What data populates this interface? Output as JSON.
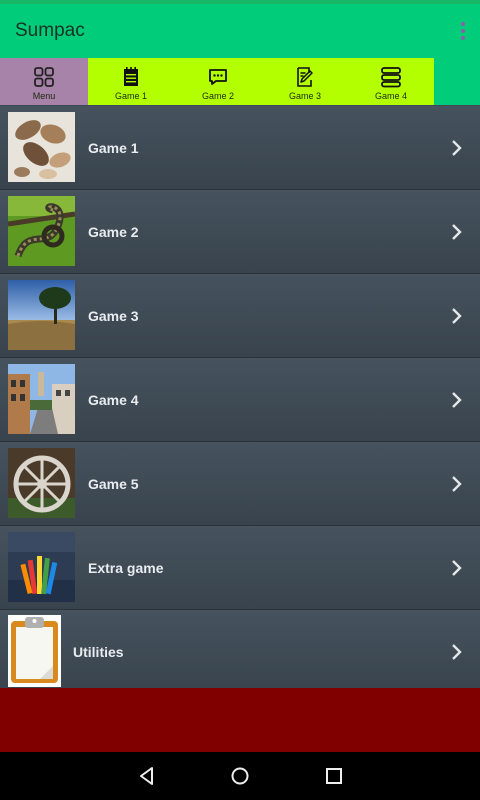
{
  "app": {
    "title": "Sumpac"
  },
  "tabs": [
    {
      "label": "Menu",
      "icon": "grid-icon",
      "active": true
    },
    {
      "label": "Game 1",
      "icon": "notepad-icon"
    },
    {
      "label": "Game 2",
      "icon": "chat-bubble-icon"
    },
    {
      "label": "Game 3",
      "icon": "edit-note-icon"
    },
    {
      "label": "Game 4",
      "icon": "stack-icon"
    }
  ],
  "list": [
    {
      "label": "Game 1",
      "thumb": "nuts-photo"
    },
    {
      "label": "Game 2",
      "thumb": "snake-photo"
    },
    {
      "label": "Game 3",
      "thumb": "tree-field-photo"
    },
    {
      "label": "Game 4",
      "thumb": "street-town-photo"
    },
    {
      "label": "Game 5",
      "thumb": "wagon-wheel-photo"
    },
    {
      "label": "Extra game",
      "thumb": "pencils-photo"
    },
    {
      "label": "Utilities",
      "thumb": "clipboard-icon"
    }
  ],
  "colors": {
    "app_bar": "#00cc7a",
    "tab_bg": "#b3ff00",
    "tab_active": "#a782a9",
    "list_bg": "#3d4954",
    "footer_band": "#800000"
  },
  "system_nav": [
    "back-icon",
    "home-icon",
    "recents-icon"
  ]
}
